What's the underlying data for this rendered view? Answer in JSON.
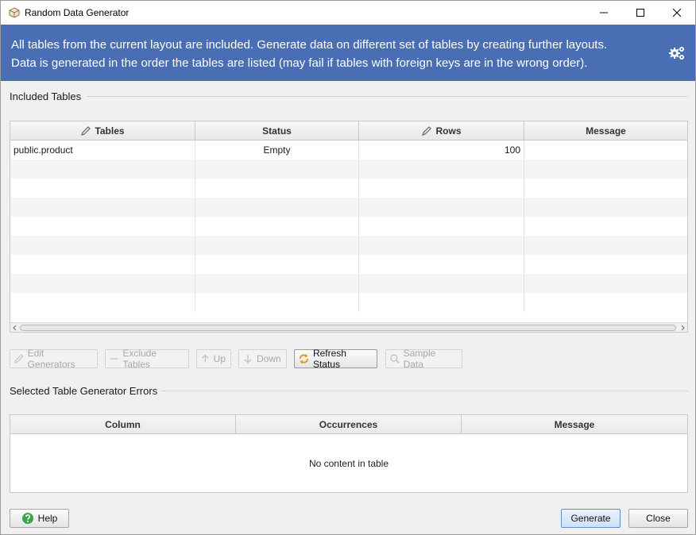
{
  "window": {
    "title": "Random Data Generator",
    "controls": {
      "minimize": "–",
      "maximize": "☐",
      "close": "✕"
    }
  },
  "banner": {
    "line1": "All tables from the current layout are included. Generate data on different set of tables by creating further layouts.",
    "line2": "Data is generated in the order the tables are listed (may fail if tables with foreign keys are in the wrong order).",
    "accent": "#4a6eb4",
    "icon": "gears-icon"
  },
  "included": {
    "title": "Included Tables",
    "columns": [
      "Tables",
      "Status",
      "Rows",
      "Message"
    ],
    "rows": [
      {
        "table": "public.product",
        "status": "Empty",
        "rows": "100",
        "message": ""
      }
    ]
  },
  "toolbar": {
    "edit_generators": "Edit Generators",
    "exclude_tables": "Exclude Tables",
    "up": "Up",
    "down": "Down",
    "refresh_status": "Refresh Status",
    "sample_data": "Sample Data"
  },
  "errors": {
    "title": "Selected Table Generator Errors",
    "columns": [
      "Column",
      "Occurrences",
      "Message"
    ],
    "empty": "No content in table"
  },
  "footer": {
    "help": "Help",
    "generate": "Generate",
    "close": "Close"
  }
}
